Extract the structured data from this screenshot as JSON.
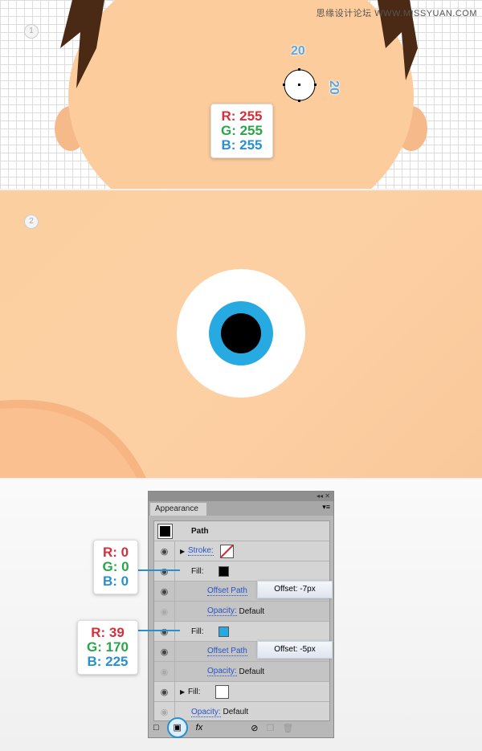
{
  "watermark": "思缘设计论坛 WWW.MISSYUAN.COM",
  "steps": [
    "1",
    "2"
  ],
  "step1": {
    "dim_w": "20",
    "dim_h": "20",
    "color": {
      "r": "R: 255",
      "g": "G: 255",
      "b": "B: 255"
    }
  },
  "colors": {
    "skin": "#fdcc9c",
    "eye_white": "#ffffff",
    "iris": "#27aae1",
    "pupil": "#000000",
    "hair": "#4a2a14",
    "accent": "#2a8fd0"
  },
  "panel": {
    "tab": "Appearance",
    "title": "Path",
    "rows": [
      {
        "label": "Stroke:",
        "link": true
      },
      {
        "label": "Fill:",
        "swatch": "#000000"
      },
      {
        "label": "Offset Path",
        "link": true,
        "popup": "Offset: -7px"
      },
      {
        "label": "Opacity:",
        "value": "Default"
      },
      {
        "label": "Fill:",
        "swatch": "#27aae1"
      },
      {
        "label": "Offset Path",
        "link": true,
        "popup": "Offset: -5px"
      },
      {
        "label": "Opacity:",
        "value": "Default"
      },
      {
        "label": "Fill:",
        "swatch": "#ffffff"
      },
      {
        "label": "Opacity:",
        "value": "Default"
      }
    ],
    "fx": "fx"
  },
  "callout_black": {
    "r": "R: 0",
    "g": "G: 0",
    "b": "B: 0"
  },
  "callout_blue": {
    "r": "R: 39",
    "g": "G: 170",
    "b": "B: 225"
  }
}
